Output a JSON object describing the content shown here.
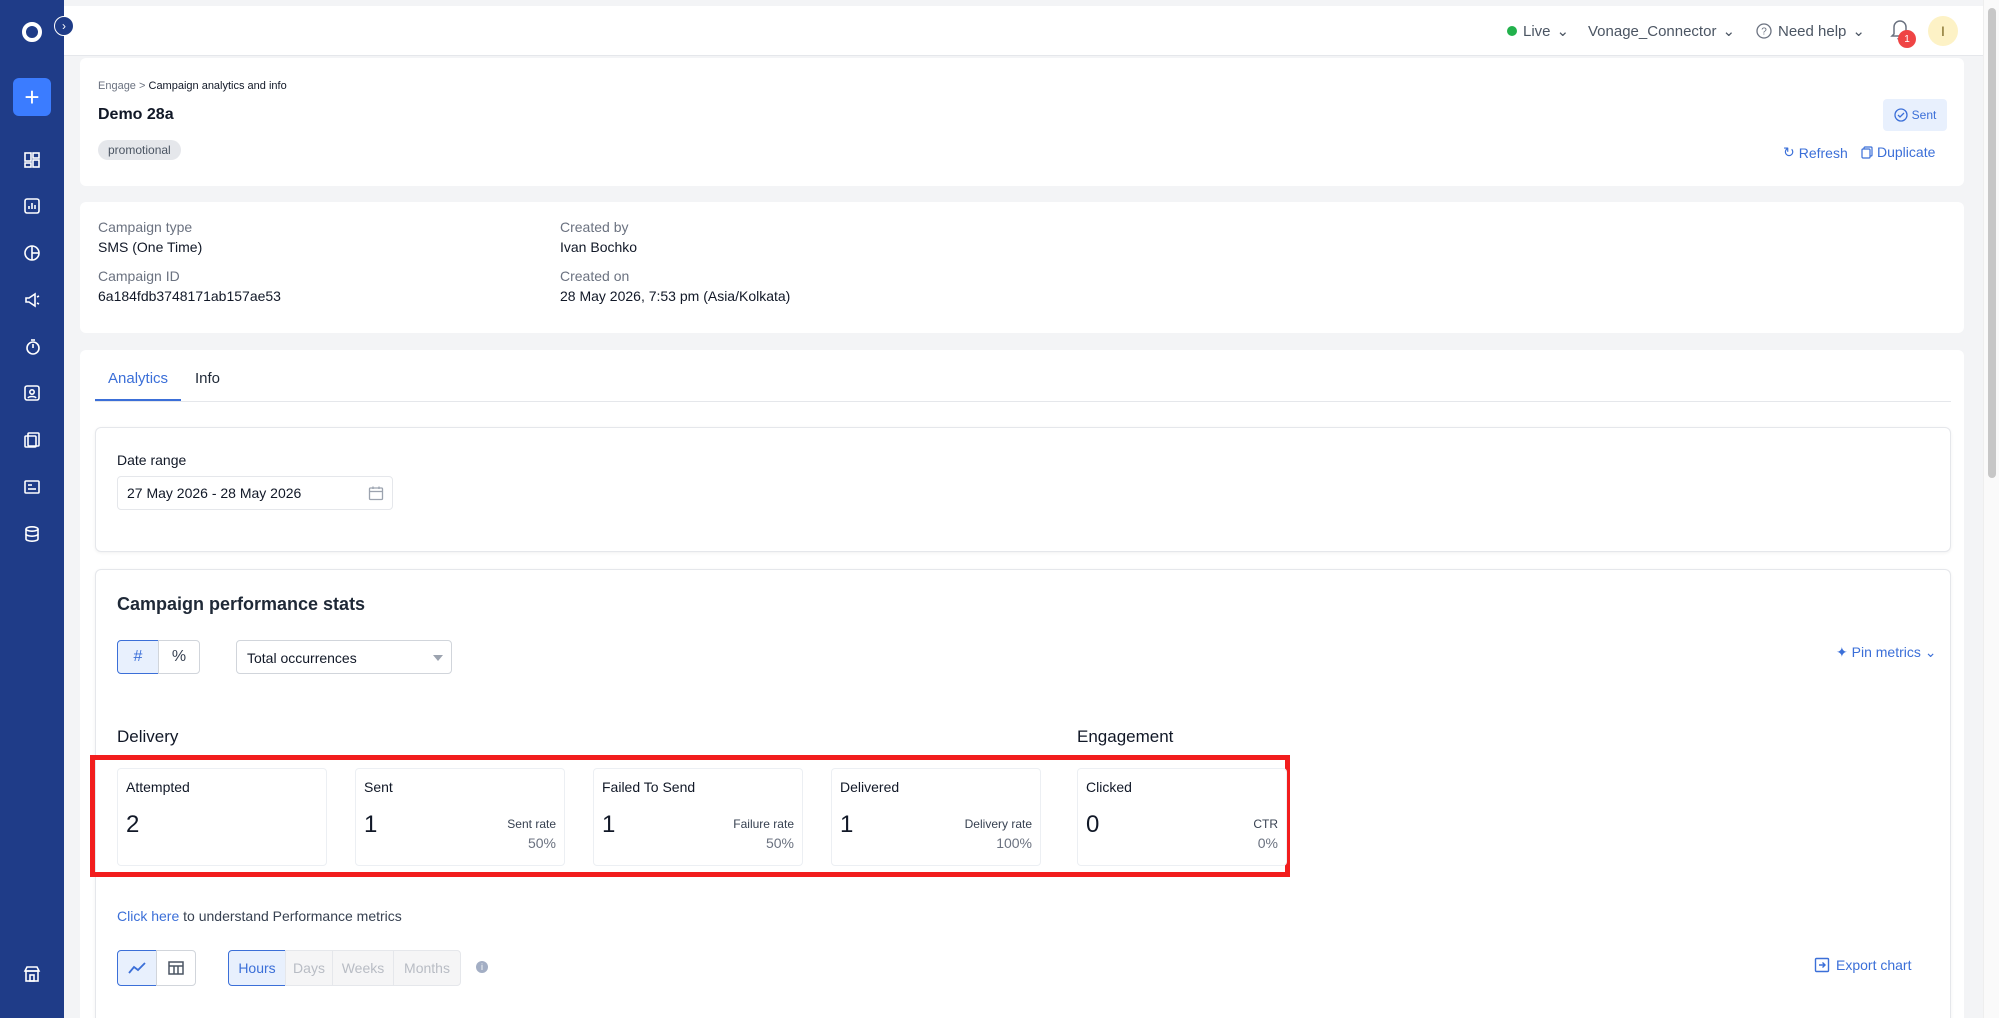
{
  "topbar": {
    "live_label": "Live",
    "workspace": "Vonage_Connector",
    "help_label": "Need help",
    "notification_count": "1",
    "avatar_initial": "I"
  },
  "header": {
    "breadcrumb_root": "Engage",
    "breadcrumb_separator": ">",
    "breadcrumb_current": "Campaign analytics and info",
    "title": "Demo 28a",
    "tag": "promotional",
    "status": "Sent",
    "refresh_label": "Refresh",
    "duplicate_label": "Duplicate"
  },
  "details": {
    "campaign_type_label": "Campaign type",
    "campaign_type": "SMS (One Time)",
    "campaign_id_label": "Campaign ID",
    "campaign_id": "6a184fdb3748171ab157ae53",
    "created_by_label": "Created by",
    "created_by": "Ivan Bochko",
    "created_on_label": "Created on",
    "created_on": "28 May 2026, 7:53 pm (Asia/Kolkata)"
  },
  "tabs": [
    {
      "label": "Analytics",
      "active": true
    },
    {
      "label": "Info",
      "active": false
    }
  ],
  "date_range": {
    "label": "Date range",
    "value": "27 May 2026 - 28 May 2026"
  },
  "performance": {
    "title": "Campaign performance stats",
    "count_toggle": "#",
    "percent_toggle": "%",
    "aggregation": "Total occurrences",
    "pin_label": "Pin metrics",
    "delivery_title": "Delivery",
    "engagement_title": "Engagement",
    "metrics": [
      {
        "label": "Attempted",
        "value": "2",
        "rate_label": "",
        "rate": ""
      },
      {
        "label": "Sent",
        "value": "1",
        "rate_label": "Sent rate",
        "rate": "50%"
      },
      {
        "label": "Failed To Send",
        "value": "1",
        "rate_label": "Failure rate",
        "rate": "50%"
      },
      {
        "label": "Delivered",
        "value": "1",
        "rate_label": "Delivery rate",
        "rate": "100%"
      },
      {
        "label": "Clicked",
        "value": "0",
        "rate_label": "CTR",
        "rate": "0%"
      }
    ],
    "help_link": "Click here",
    "help_text": "to understand Performance metrics",
    "granularity": [
      "Hours",
      "Days",
      "Weeks",
      "Months"
    ],
    "granularity_selected": "Hours",
    "export_label": "Export chart"
  },
  "colors": {
    "sidebar": "#1f3c88",
    "accent": "#3b6fd8",
    "highlight": "#f21d1d",
    "live": "#22b14c"
  }
}
